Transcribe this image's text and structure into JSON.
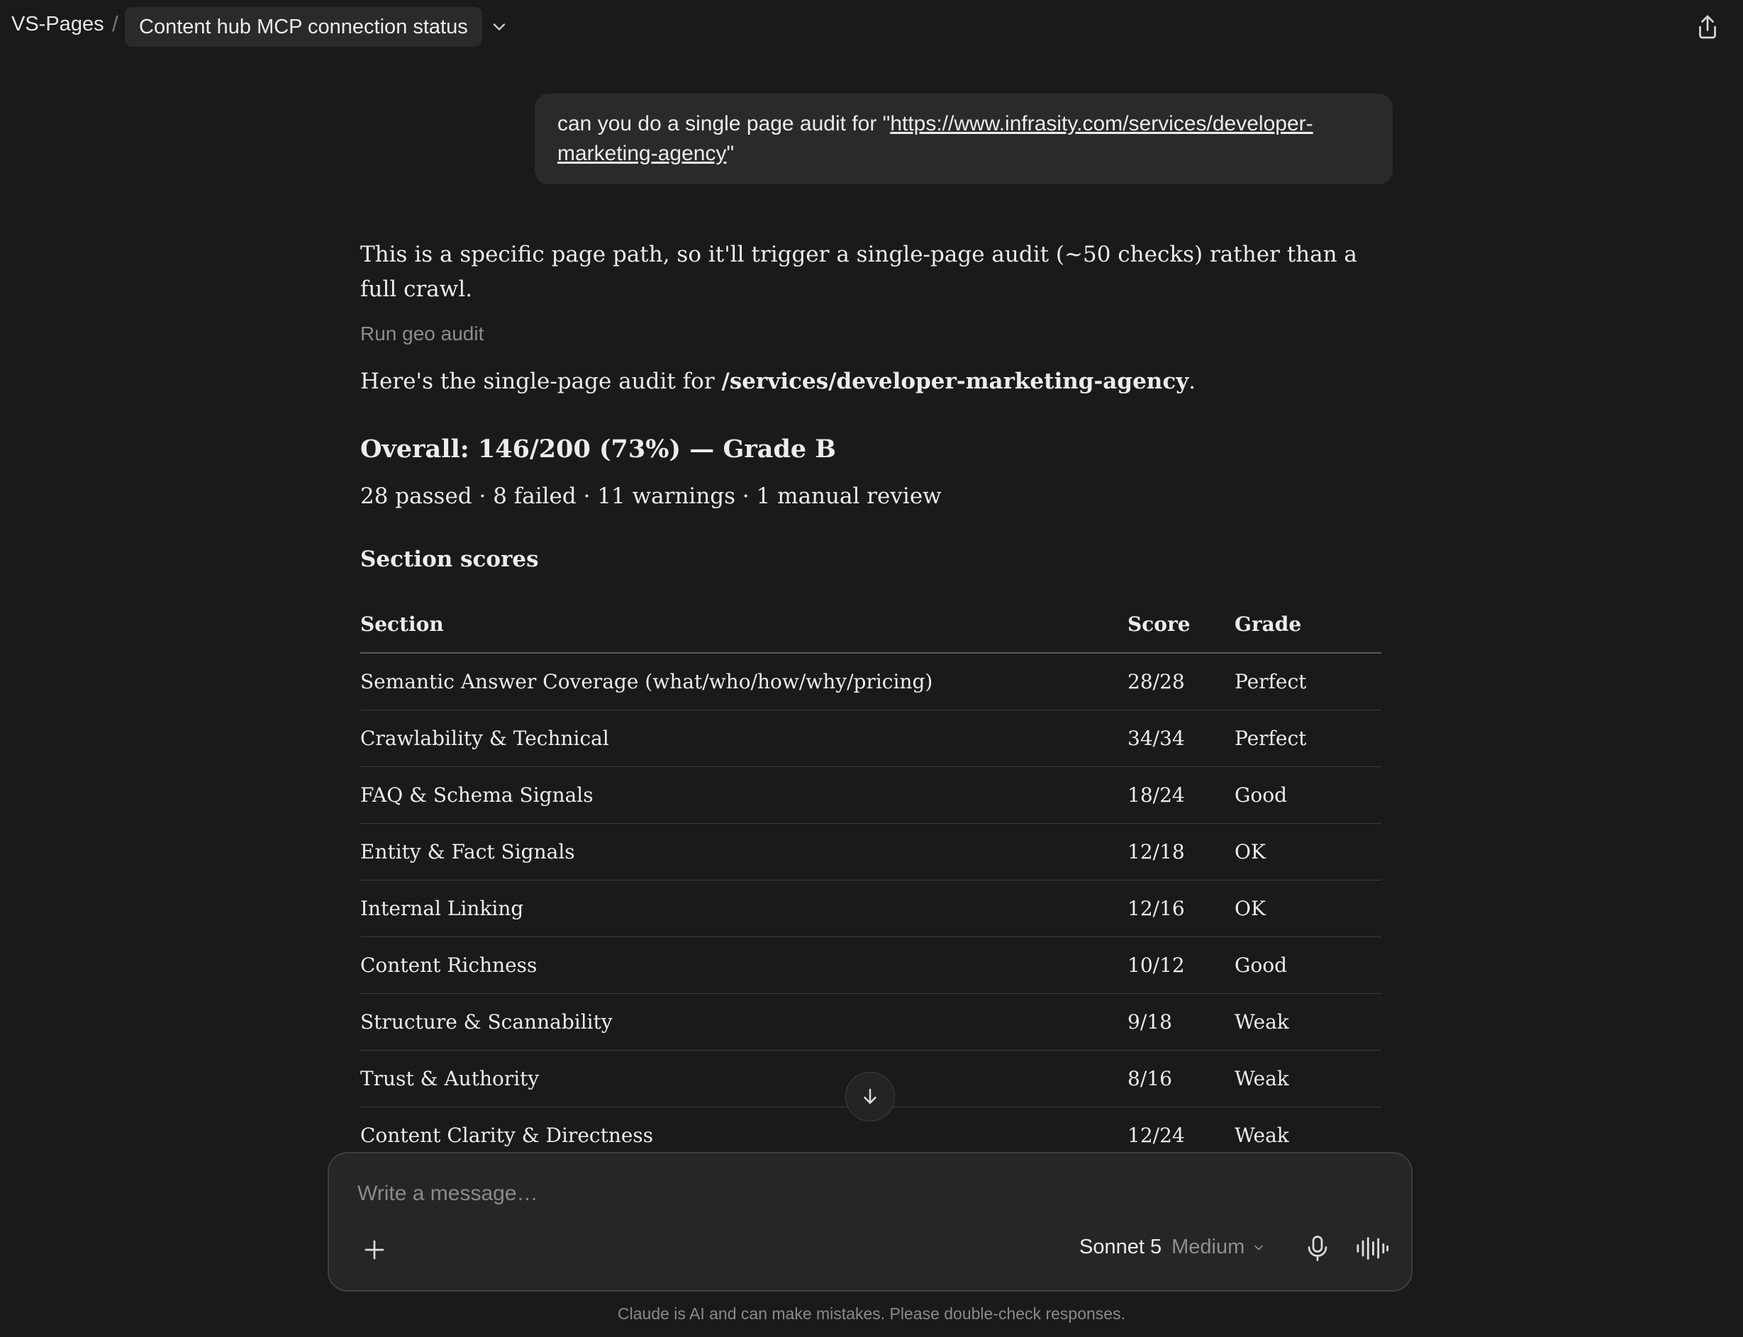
{
  "header": {
    "project": "VS-Pages",
    "separator": "/",
    "chat_title": "Content hub MCP connection status"
  },
  "user_message": {
    "prefix": "can you do a single page audit for  \"",
    "link": "https://www.infrasity.com/services/developer-marketing-agency",
    "suffix": "\""
  },
  "response": {
    "intro": "This is a specific page path, so it'll trigger a single-page audit (~50 checks) rather than a full crawl.",
    "tool_call": "Run geo audit",
    "lead_prefix": "Here's the single-page audit for ",
    "lead_path": "/services/developer-marketing-agency",
    "lead_suffix": ".",
    "overall": "Overall: 146/200 (73%) — Grade B",
    "summary": "28 passed · 8 failed · 11 warnings · 1 manual review",
    "section_scores_title": "Section scores",
    "table": {
      "headers": [
        "Section",
        "Score",
        "Grade"
      ],
      "rows": [
        [
          "Semantic Answer Coverage (what/who/how/why/pricing)",
          "28/28",
          "Perfect"
        ],
        [
          "Crawlability & Technical",
          "34/34",
          "Perfect"
        ],
        [
          "FAQ & Schema Signals",
          "18/24",
          "Good"
        ],
        [
          "Entity & Fact Signals",
          "12/18",
          "OK"
        ],
        [
          "Internal Linking",
          "12/16",
          "OK"
        ],
        [
          "Content Richness",
          "10/12",
          "Good"
        ],
        [
          "Structure & Scannability",
          "9/18",
          "Weak"
        ],
        [
          "Trust & Authority",
          "8/16",
          "Weak"
        ],
        [
          "Content Clarity & Directness",
          "12/24",
          "Weak"
        ]
      ]
    }
  },
  "composer": {
    "placeholder": "Write a message…",
    "model": "Sonnet 5",
    "effort": "Medium"
  },
  "footer": {
    "disclaimer": "Claude is AI and can make mistakes. Please double-check responses."
  },
  "icons": {
    "chevron": "chevron-down-icon",
    "share": "share-icon",
    "scroll": "arrow-down-icon",
    "plus": "plus-icon",
    "mic": "microphone-icon",
    "voice": "voice-mode-icon"
  },
  "colors": {
    "background": "#1a1a1a",
    "surface": "#2a2a2a",
    "text": "#ececec",
    "muted": "#8a8a8a"
  }
}
